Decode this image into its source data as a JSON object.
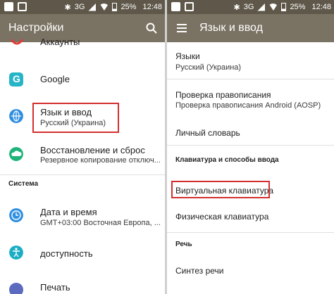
{
  "left": {
    "status": {
      "network": "3G",
      "battery": "25%",
      "time": "12:48"
    },
    "title": "Настройки",
    "items": [
      {
        "title": "Аккаунты"
      },
      {
        "title": "Google"
      },
      {
        "title": "Язык и ввод",
        "subtitle": "Русский (Украина)"
      },
      {
        "title": "Восстановление и сброс",
        "subtitle": "Резервное копирование отключ..."
      }
    ],
    "section_system": "Система",
    "system_items": [
      {
        "title": "Дата и время",
        "subtitle": "GMT+03:00 Восточная Европа, ..."
      },
      {
        "title": "доступность"
      },
      {
        "title": "Печать"
      }
    ]
  },
  "right": {
    "status": {
      "network": "3G",
      "battery": "25%",
      "time": "12:48"
    },
    "title": "Язык и ввод",
    "languages": {
      "title": "Языки",
      "subtitle": "Русский (Украина)"
    },
    "spellcheck": {
      "title": "Проверка правописания",
      "subtitle": "Проверка правописания Android (AOSP)"
    },
    "dictionary": "Личный словарь",
    "section_keyboard": "Клавиатура и способы ввода",
    "virtual_keyboard": "Виртуальная клавиатура",
    "physical_keyboard": "Физическая клавиатура",
    "section_speech": "Речь",
    "tts": "Синтез речи"
  },
  "colors": {
    "statusbar": "#5f584a",
    "appbar": "#7a7263",
    "highlight": "#d32f2f",
    "google_icon": "#26b5c7",
    "lang_icon": "#2f8fe0",
    "restore_icon": "#1fb37a",
    "date_icon": "#2f8fe0",
    "access_icon": "#1aaec4"
  }
}
